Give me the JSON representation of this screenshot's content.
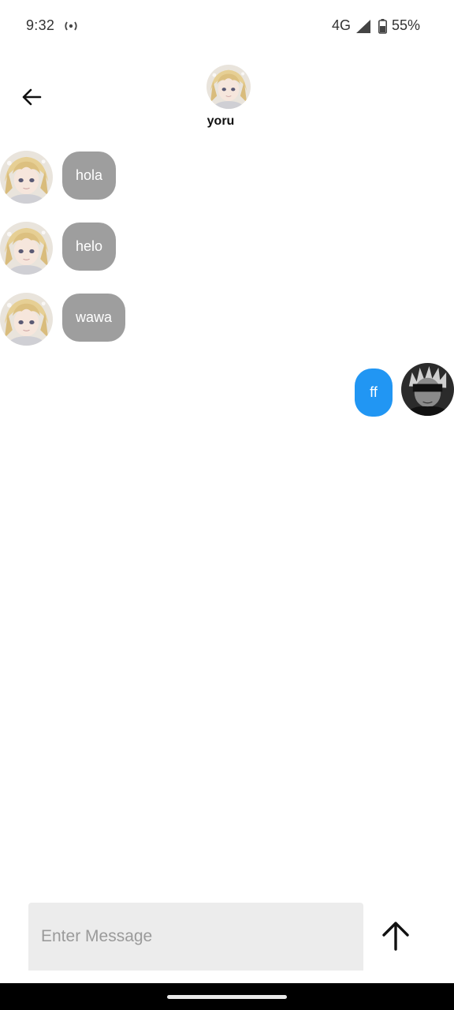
{
  "status_bar": {
    "time": "9:32",
    "network": "4G",
    "battery": "55%",
    "icons": [
      "hotspot-icon",
      "signal-icon",
      "battery-icon"
    ]
  },
  "header": {
    "title": "yoru",
    "back_icon": "arrow-left-icon"
  },
  "messages": [
    {
      "text": "hola",
      "direction": "received"
    },
    {
      "text": "helo",
      "direction": "received"
    },
    {
      "text": "wawa",
      "direction": "received"
    },
    {
      "text": "ff",
      "direction": "sent"
    }
  ],
  "composer": {
    "placeholder": "Enter Message",
    "value": "",
    "send_icon": "arrow-up-icon"
  },
  "colors": {
    "received_bubble": "#9e9e9e",
    "sent_bubble": "#2196f3",
    "input_background": "#ececec"
  }
}
